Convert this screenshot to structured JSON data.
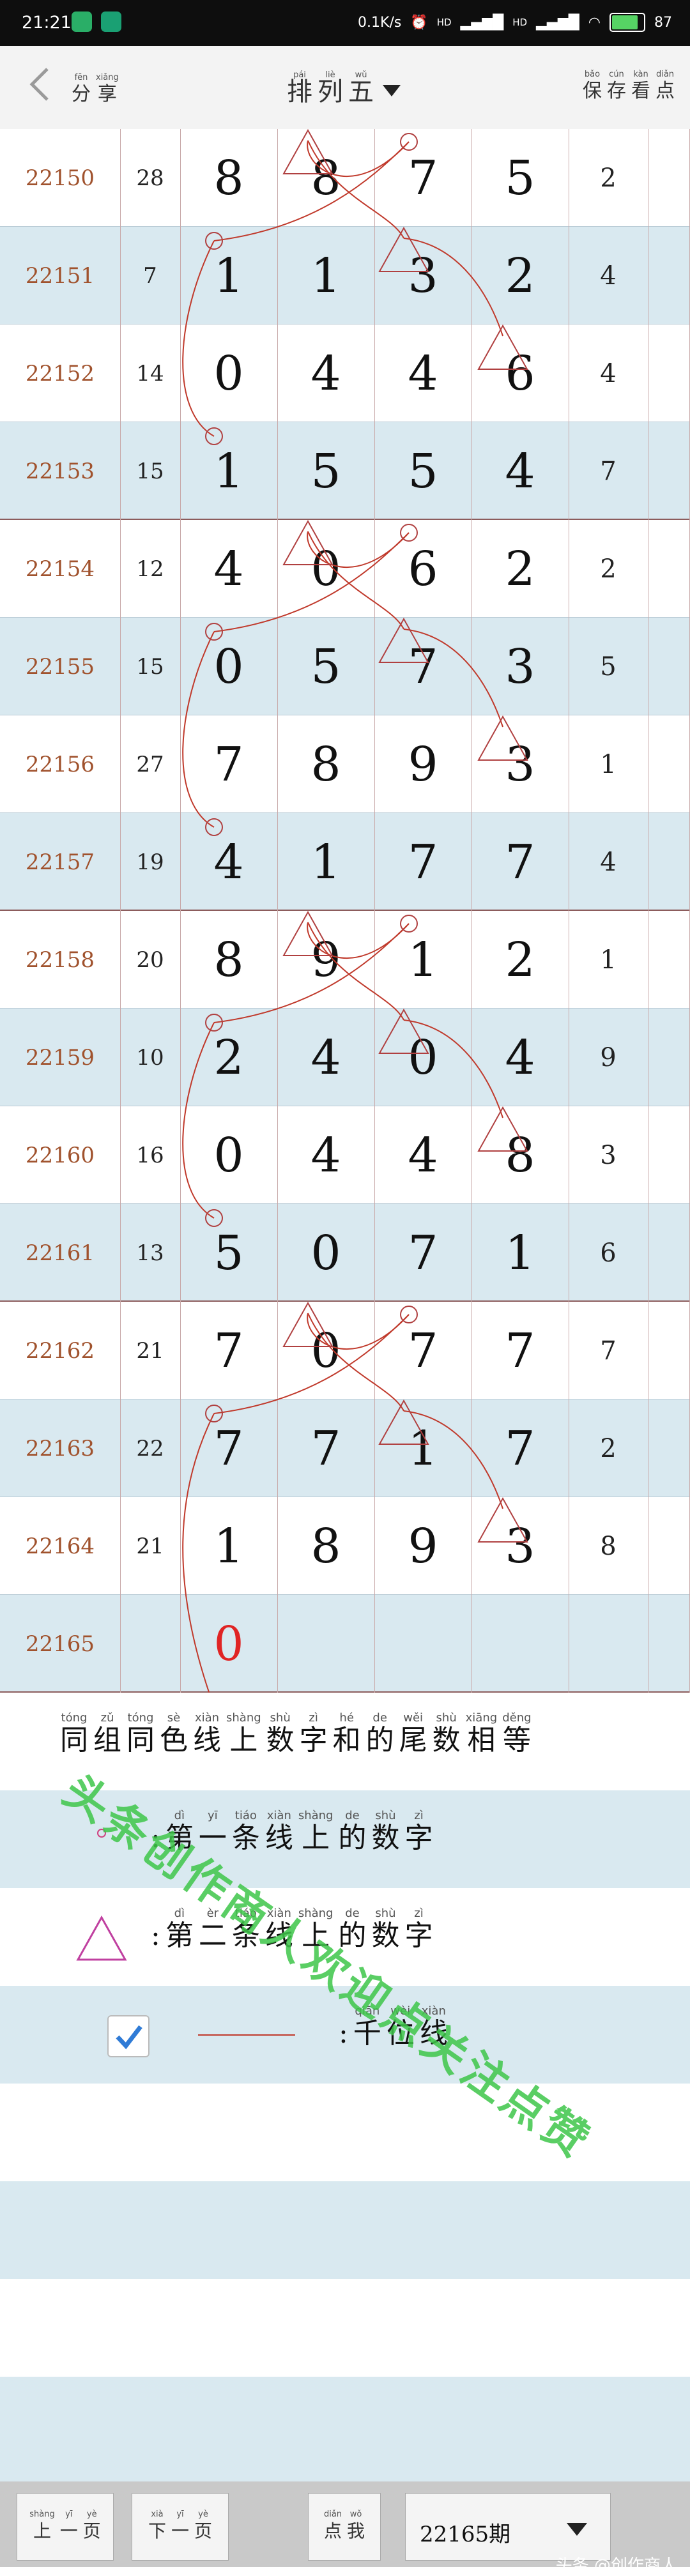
{
  "status_bar": {
    "time": "21:21",
    "net_speed": "0.1K/s",
    "signal_labels": [
      "HD",
      "HD"
    ],
    "battery": "87"
  },
  "header": {
    "share": [
      {
        "py": "fēn",
        "hz": "分"
      },
      {
        "py": "xiǎng",
        "hz": "享"
      }
    ],
    "title": [
      {
        "py": "pái",
        "hz": "排"
      },
      {
        "py": "liè",
        "hz": "列"
      },
      {
        "py": "wǔ",
        "hz": "五"
      }
    ],
    "actions": [
      {
        "py": "bǎo",
        "hz": "保"
      },
      {
        "py": "cún",
        "hz": "存"
      },
      {
        "py": "kàn",
        "hz": "看"
      },
      {
        "py": "diǎn",
        "hz": "点"
      }
    ]
  },
  "rows": [
    {
      "issue": "22150",
      "sum": "28",
      "digits": [
        "8",
        "8",
        "7",
        "5"
      ],
      "tail": "2"
    },
    {
      "issue": "22151",
      "sum": "7",
      "digits": [
        "1",
        "1",
        "3",
        "2"
      ],
      "tail": "4"
    },
    {
      "issue": "22152",
      "sum": "14",
      "digits": [
        "0",
        "4",
        "4",
        "6"
      ],
      "tail": "4"
    },
    {
      "issue": "22153",
      "sum": "15",
      "digits": [
        "1",
        "5",
        "5",
        "4"
      ],
      "tail": "7"
    },
    {
      "issue": "22154",
      "sum": "12",
      "digits": [
        "4",
        "0",
        "6",
        "2"
      ],
      "tail": "2"
    },
    {
      "issue": "22155",
      "sum": "15",
      "digits": [
        "0",
        "5",
        "7",
        "3"
      ],
      "tail": "5"
    },
    {
      "issue": "22156",
      "sum": "27",
      "digits": [
        "7",
        "8",
        "9",
        "3"
      ],
      "tail": "1"
    },
    {
      "issue": "22157",
      "sum": "19",
      "digits": [
        "4",
        "1",
        "7",
        "7"
      ],
      "tail": "4"
    },
    {
      "issue": "22158",
      "sum": "20",
      "digits": [
        "8",
        "9",
        "1",
        "2"
      ],
      "tail": "1"
    },
    {
      "issue": "22159",
      "sum": "10",
      "digits": [
        "2",
        "4",
        "0",
        "4"
      ],
      "tail": "9"
    },
    {
      "issue": "22160",
      "sum": "16",
      "digits": [
        "0",
        "4",
        "4",
        "8"
      ],
      "tail": "3"
    },
    {
      "issue": "22161",
      "sum": "13",
      "digits": [
        "5",
        "0",
        "7",
        "1"
      ],
      "tail": "6"
    },
    {
      "issue": "22162",
      "sum": "21",
      "digits": [
        "7",
        "0",
        "7",
        "7"
      ],
      "tail": "7"
    },
    {
      "issue": "22163",
      "sum": "22",
      "digits": [
        "7",
        "7",
        "1",
        "7"
      ],
      "tail": "2"
    },
    {
      "issue": "22164",
      "sum": "21",
      "digits": [
        "1",
        "8",
        "9",
        "3"
      ],
      "tail": "8"
    },
    {
      "issue": "22165",
      "sum": "",
      "digits": [
        "0",
        "",
        "",
        ""
      ],
      "tail": ""
    }
  ],
  "legend": {
    "line1": [
      {
        "py": "tóng",
        "hz": "同"
      },
      {
        "py": "zǔ",
        "hz": "组"
      },
      {
        "py": "tóng",
        "hz": "同"
      },
      {
        "py": "sè",
        "hz": "色"
      },
      {
        "py": "xiàn",
        "hz": "线"
      },
      {
        "py": "shàng",
        "hz": "上"
      },
      {
        "py": "shù",
        "hz": "数"
      },
      {
        "py": "zì",
        "hz": "字"
      },
      {
        "py": "hé",
        "hz": "和"
      },
      {
        "py": "de",
        "hz": "的"
      },
      {
        "py": "wěi",
        "hz": "尾"
      },
      {
        "py": "shù",
        "hz": "数"
      },
      {
        "py": "xiāng",
        "hz": "相"
      },
      {
        "py": "děng",
        "hz": "等"
      }
    ],
    "line2": [
      {
        "py": "",
        "hz": ":"
      },
      {
        "py": "dì",
        "hz": "第"
      },
      {
        "py": "yī",
        "hz": "一"
      },
      {
        "py": "tiáo",
        "hz": "条"
      },
      {
        "py": "xiàn",
        "hz": "线"
      },
      {
        "py": "shàng",
        "hz": "上"
      },
      {
        "py": "de",
        "hz": "的"
      },
      {
        "py": "shù",
        "hz": "数"
      },
      {
        "py": "zì",
        "hz": "字"
      }
    ],
    "line3": [
      {
        "py": "",
        "hz": ":"
      },
      {
        "py": "dì",
        "hz": "第"
      },
      {
        "py": "èr",
        "hz": "二"
      },
      {
        "py": "tiáo",
        "hz": "条"
      },
      {
        "py": "xiàn",
        "hz": "线"
      },
      {
        "py": "shàng",
        "hz": "上"
      },
      {
        "py": "de",
        "hz": "的"
      },
      {
        "py": "shù",
        "hz": "数"
      },
      {
        "py": "zì",
        "hz": "字"
      }
    ],
    "line4": [
      {
        "py": "",
        "hz": ":"
      },
      {
        "py": "qiān",
        "hz": "千"
      },
      {
        "py": "wèi",
        "hz": "位"
      },
      {
        "py": "xiàn",
        "hz": "线"
      }
    ],
    "checkbox_checked": true
  },
  "bottom": {
    "prev": [
      {
        "py": "shàng",
        "hz": "上"
      },
      {
        "py": "yī",
        "hz": "一"
      },
      {
        "py": "yè",
        "hz": "页"
      }
    ],
    "next": [
      {
        "py": "xià",
        "hz": "下"
      },
      {
        "py": "yī",
        "hz": "一"
      },
      {
        "py": "yè",
        "hz": "页"
      }
    ],
    "me": [
      {
        "py": "diǎn",
        "hz": "点"
      },
      {
        "py": "wǒ",
        "hz": "我"
      }
    ],
    "period": "22165期",
    "credit": "头条 @创作商人"
  },
  "watermark": "头条创作商人欢迎点关注点赞",
  "colors": {
    "issue": "#a0522d",
    "line": "#c0392b",
    "alt_row": "#d9e9f0",
    "watermark": "#3ec64a"
  }
}
